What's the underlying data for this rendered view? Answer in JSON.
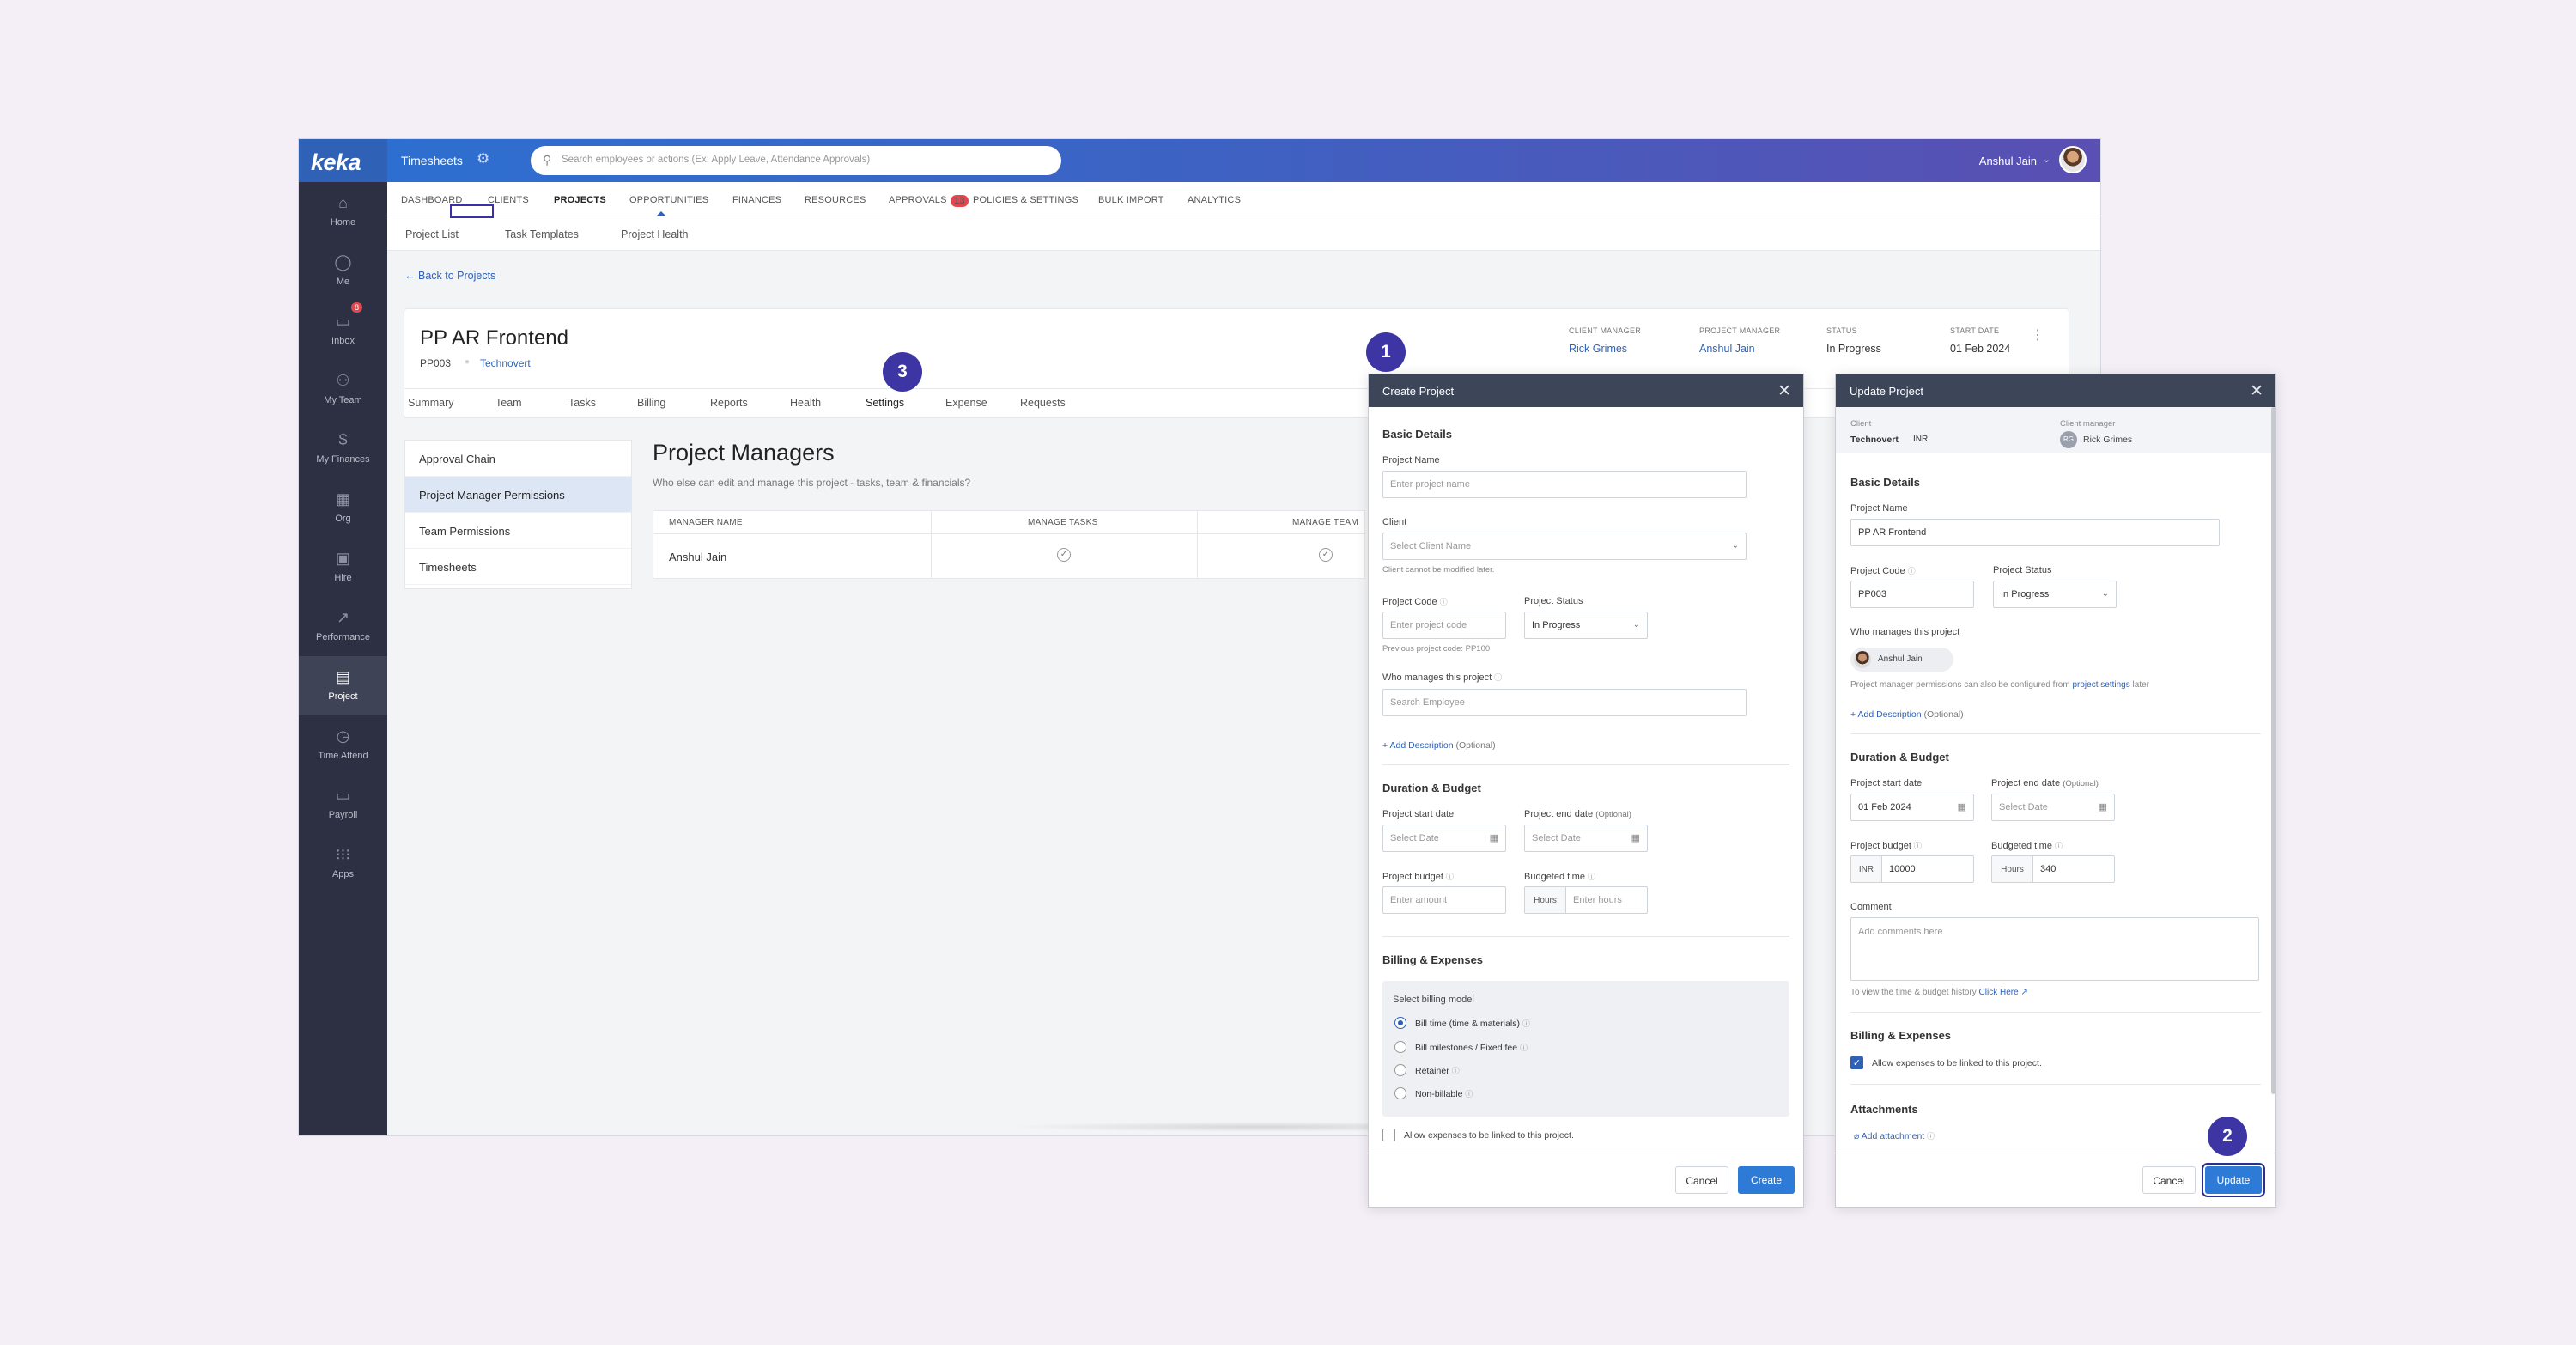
{
  "brand": {
    "logo": "keka"
  },
  "sidebar": {
    "items": [
      {
        "label": "Home",
        "icon": "⌂"
      },
      {
        "label": "Me",
        "icon": "◯"
      },
      {
        "label": "Inbox",
        "icon": "▭",
        "badge": "8"
      },
      {
        "label": "My Team",
        "icon": "⚇"
      },
      {
        "label": "My Finances",
        "icon": "$"
      },
      {
        "label": "Org",
        "icon": "▦"
      },
      {
        "label": "Hire",
        "icon": "▣"
      },
      {
        "label": "Performance",
        "icon": "↗"
      },
      {
        "label": "Project",
        "icon": "▤"
      },
      {
        "label": "Time Attend",
        "icon": "◷"
      },
      {
        "label": "Payroll",
        "icon": "▭"
      },
      {
        "label": "Apps",
        "icon": "⁝⁝⁝"
      }
    ]
  },
  "topbar": {
    "title": "Timesheets",
    "search_placeholder": "Search employees or actions (Ex: Apply Leave, Attendance Approvals)",
    "user_name": "Anshul Jain"
  },
  "topnav": {
    "items": [
      "DASHBOARD",
      "CLIENTS",
      "PROJECTS",
      "OPPORTUNITIES",
      "FINANCES",
      "RESOURCES",
      "APPROVALS",
      "POLICIES & SETTINGS",
      "BULK IMPORT",
      "ANALYTICS"
    ],
    "approvals_badge": "13"
  },
  "subnav": {
    "items": [
      "Project List",
      "Task Templates",
      "Project Health"
    ]
  },
  "back_link": "Back to Projects",
  "project": {
    "title": "PP AR Frontend",
    "code": "PP003",
    "client": "Technovert",
    "meta": [
      {
        "label": "CLIENT MANAGER",
        "value": "Rick Grimes"
      },
      {
        "label": "PROJECT MANAGER",
        "value": "Anshul Jain"
      },
      {
        "label": "STATUS",
        "value": "In Progress"
      },
      {
        "label": "START DATE",
        "value": "01 Feb 2024"
      }
    ],
    "tabs": [
      "Summary",
      "Team",
      "Tasks",
      "Billing",
      "Reports",
      "Health",
      "Settings",
      "Expense",
      "Requests"
    ]
  },
  "settings_menu": [
    "Approval Chain",
    "Project Manager Permissions",
    "Team Permissions",
    "Timesheets"
  ],
  "managers": {
    "title": "Project Managers",
    "subtitle": "Who else can edit and manage this project - tasks, team & financials?",
    "headers": [
      "MANAGER NAME",
      "MANAGE TASKS",
      "MANAGE TEAM"
    ],
    "rows": [
      {
        "name": "Anshul Jain"
      }
    ]
  },
  "steps": [
    "1",
    "2",
    "3"
  ],
  "create": {
    "title": "Create Project",
    "basic": "Basic Details",
    "name_label": "Project Name",
    "name_ph": "Enter project name",
    "client_label": "Client",
    "client_ph": "Select Client Name",
    "client_hint": "Client cannot be modified later.",
    "code_label": "Project Code",
    "code_ph": "Enter project code",
    "code_hint": "Previous project code: PP100",
    "status_label": "Project Status",
    "status_value": "In Progress",
    "who_label": "Who manages this project",
    "who_ph": "Search Employee",
    "add_desc": "+ Add Description",
    "optional": "(Optional)",
    "duration": "Duration & Budget",
    "start_label": "Project start date",
    "start_ph": "Select Date",
    "end_label": "Project end date",
    "end_opt": "(Optional)",
    "end_ph": "Select Date",
    "budget_label": "Project budget",
    "budget_ph": "Enter amount",
    "btime_label": "Budgeted time",
    "hours": "Hours",
    "btime_ph": "Enter hours",
    "billing": "Billing & Expenses",
    "billing_model": "Select billing model",
    "models": [
      "Bill time (time & materials)",
      "Bill milestones / Fixed fee",
      "Retainer",
      "Non-billable"
    ],
    "allow_exp": "Allow expenses to be linked to this project.",
    "cancel": "Cancel",
    "submit": "Create"
  },
  "update": {
    "title": "Update Project",
    "client_label": "Client",
    "client_value": "Technovert",
    "currency": "INR",
    "cm_label": "Client manager",
    "cm_initials": "RG",
    "cm_value": "Rick Grimes",
    "basic": "Basic Details",
    "name_label": "Project Name",
    "name_value": "PP AR Frontend",
    "code_label": "Project Code",
    "code_value": "PP003",
    "status_label": "Project Status",
    "status_value": "In Progress",
    "who_label": "Who manages this project",
    "manager_chip": "Anshul Jain",
    "perm_text": "Project manager permissions can also be configured from",
    "perm_link": "project settings",
    "perm_tail": "later",
    "add_desc": "+ Add Description",
    "optional": "(Optional)",
    "duration": "Duration & Budget",
    "start_label": "Project start date",
    "start_value": "01 Feb 2024",
    "end_label": "Project end date",
    "end_opt": "(Optional)",
    "end_ph": "Select Date",
    "budget_label": "Project budget",
    "budget_prefix": "INR",
    "budget_value": "10000",
    "btime_label": "Budgeted time",
    "hours": "Hours",
    "btime_value": "340",
    "comment_label": "Comment",
    "comment_ph": "Add comments here",
    "history_text": "To view the time & budget history",
    "history_link": "Click Here",
    "billing": "Billing & Expenses",
    "allow_exp": "Allow expenses to be linked to this project.",
    "attachments": "Attachments",
    "add_attachment": "Add attachment",
    "cancel": "Cancel",
    "submit": "Update"
  }
}
